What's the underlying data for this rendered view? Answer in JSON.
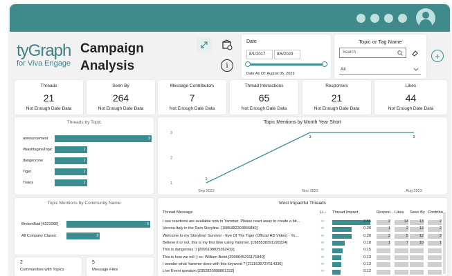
{
  "app": {
    "logo": "tyGraph",
    "logo_sub": "for Viva Engage",
    "title_line1": "Campaign",
    "title_line2": "Analysis"
  },
  "date_filter": {
    "label": "Date",
    "start": "8/1/2017",
    "end": "8/5/2023",
    "as_of": "Date As Of: August 05, 2023"
  },
  "topic_filter": {
    "label": "Topic or Tag Name",
    "search_placeholder": "Search",
    "select_value": "All"
  },
  "kpis": [
    {
      "title": "Threads",
      "value": "21",
      "sub": "Not Enough Date Data"
    },
    {
      "title": "Seen By",
      "value": "264",
      "sub": "Not Enough Date Data"
    },
    {
      "title": "Message Contributors",
      "value": "7",
      "sub": "Not Enough Date Data"
    },
    {
      "title": "Thread Interactions",
      "value": "65",
      "sub": "Not Enough Date Data"
    },
    {
      "title": "Responses",
      "value": "21",
      "sub": "Not Enough Date Data"
    },
    {
      "title": "Likes",
      "value": "44",
      "sub": "Not Enough Date Data"
    }
  ],
  "threads_by_topic": {
    "title": "Threads by Topic",
    "chart_data": {
      "type": "bar",
      "categories": [
        "announcement",
        "#hashtaginaTopic",
        "dangerzone",
        "Tiger",
        "Trains"
      ],
      "values": [
        3,
        1,
        1,
        1,
        1
      ],
      "max": 3
    }
  },
  "mentions_by_month": {
    "title": "Topic Mentions by Month Year Short",
    "chart_data": {
      "type": "line",
      "x": [
        "Sep 2022",
        "Nov 2022",
        "Aug 2023"
      ],
      "y": [
        1,
        3,
        3
      ],
      "yticks": [
        "3",
        "2",
        "1"
      ],
      "ylim": [
        1,
        3
      ]
    }
  },
  "mentions_by_community": {
    "title": "Topic Mentions by Community Name",
    "chart_data": {
      "type": "bar",
      "categories": [
        "BrokenBad [4321065]",
        "All Company Classic"
      ],
      "values": [
        5,
        2
      ],
      "max": 5
    }
  },
  "mini_cards": [
    {
      "value": "2",
      "label": "Communities with Topics"
    },
    {
      "value": "5",
      "label": "Message Files"
    }
  ],
  "impactful_threads": {
    "title": "Most Impactful Threads",
    "columns": [
      "Thread Message",
      "Li...",
      "Thread Impact",
      "Respon...",
      "Likes",
      "Seen By",
      "Contribu..."
    ],
    "rows": [
      {
        "msg": "I see reactions are available now in Yammer. Please react away to create a bit...",
        "impact": "0.55",
        "impact_frac": 1.0,
        "resp": "2",
        "likes": "14",
        "seen": "13",
        "contrib": "2"
      },
      {
        "msg": "Verona Italy in the Rain Storyline. [1985382303866880]",
        "impact": "0.28",
        "impact_frac": 0.51,
        "resp": "1",
        "likes": "2",
        "seen": "12",
        "contrib": "2"
      },
      {
        "msg": "Welcome to my Storyline!  Survivor - Eye Of The Tiger (Official HD Video) - Yo...",
        "impact": "0.28",
        "impact_frac": 0.51,
        "resp": "2",
        "likes": "5",
        "seen": "12",
        "contrib": "2"
      },
      {
        "msg": "Believe it or not, this is my first time using Yammer. [1985538391220224]",
        "impact": "0.18",
        "impact_frac": 0.33,
        "resp": "1",
        "likes": "7",
        "seen": "10",
        "contrib": "1"
      },
      {
        "msg": "This is dangerous :) [2006108825362432]",
        "impact": "0.15",
        "impact_frac": 0.27,
        "resp": "",
        "likes": "",
        "seen": "",
        "contrib": ""
      },
      {
        "msg": "This is how we roll :)  cc: William Belet [2009045291171840]",
        "impact": "0.13",
        "impact_frac": 0.24,
        "resp": "",
        "likes": "",
        "seen": "",
        "contrib": ""
      },
      {
        "msg": "I wonder what Yammer does with this keyword ? [2111639737614336]",
        "impact": "0.13",
        "impact_frac": 0.24,
        "resp": "",
        "likes": "",
        "seen": "",
        "contrib": ""
      },
      {
        "msg": "Live Event question [2352820990861312]",
        "impact": "0.12",
        "impact_frac": 0.22,
        "resp": "",
        "likes": "",
        "seen": "",
        "contrib": ""
      }
    ]
  },
  "colors": {
    "accent": "#3f8a8b",
    "bar": "#3c8d8f",
    "background": "#f2f2f2"
  }
}
